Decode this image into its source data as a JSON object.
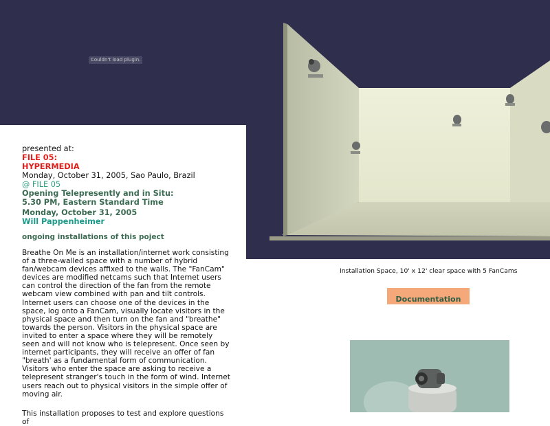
{
  "plugin_message": "Couldn't load plugin.",
  "presented": {
    "label": "presented at:",
    "event_line1": "FILE 05:",
    "event_line2": "HYPERMEDIA",
    "date_place": "Monday, October 31, 2005, Sao Paulo, Brazil",
    "at_file": "@ FILE 05",
    "opening": "Opening Telepresently and in Situ:",
    "time": "5.30 PM, Eastern Standard Time",
    "date": "Monday, October 31, 2005",
    "author": "Will Pappenheimer"
  },
  "ongoing_label": "ongoing installations of this poject",
  "description": "Breathe On Me is an installation/internet work consisting of a three-walled space with a number of hybrid fan/webcam devices affixed to the walls. The \"FanCam\" devices are modified netcams such that Internet users can control the direction of the fan from the remote webcam view combined with pan and tilt controls. Internet users can choose one of the devices in the space, log onto a FanCam, visually locate visitors in the physical space and then turn on the fan and \"breathe\" towards the person. Visitors in the physical space are invited to enter a space where they will be remotely seen and will not know who is telepresent. Once seen by internet participants, they will receive an offer of fan \"breath' as a fundamental form of communication. Visitors who enter the space are asking to receive a telepresent stranger's touch in the form of wind. Internet users reach out to physical visitors in the simple offer of moving air.",
  "description2": "This installation proposes to test and explore questions of",
  "caption": "Installation Space, 10' x 12' clear space with 5 FanCams",
  "documentation_button": "Documentation",
  "colors": {
    "background_dark": "#2f2e4c",
    "red": "#e0201a",
    "green": "#3b6b52",
    "teal": "#1c9a8a",
    "button": "#f5a97b"
  }
}
